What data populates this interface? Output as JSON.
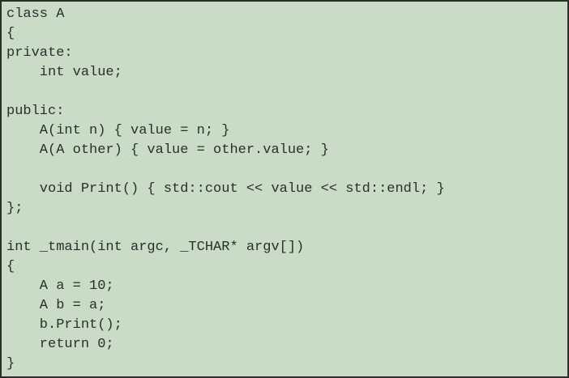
{
  "code": {
    "lines": [
      "class A",
      "{",
      "private:",
      "    int value;",
      "",
      "public:",
      "    A(int n) { value = n; }",
      "    A(A other) { value = other.value; }",
      "",
      "    void Print() { std::cout << value << std::endl; }",
      "};",
      "",
      "int _tmain(int argc, _TCHAR* argv[])",
      "{",
      "    A a = 10;",
      "    A b = a;",
      "    b.Print();",
      "    return 0;",
      "}"
    ]
  }
}
